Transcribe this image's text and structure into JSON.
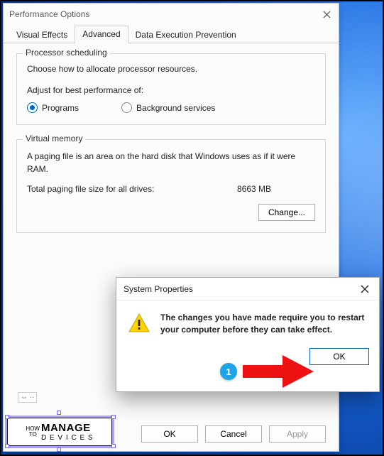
{
  "perf": {
    "title": "Performance Options",
    "tabs": [
      "Visual Effects",
      "Advanced",
      "Data Execution Prevention"
    ],
    "active_tab": 1,
    "processor": {
      "legend": "Processor scheduling",
      "desc": "Choose how to allocate processor resources.",
      "sub": "Adjust for best performance of:",
      "options": [
        "Programs",
        "Background services"
      ],
      "selected": 0
    },
    "vm": {
      "legend": "Virtual memory",
      "desc": "A paging file is an area on the hard disk that Windows uses as if it were RAM.",
      "total_label": "Total paging file size for all drives:",
      "total_value": "8663 MB",
      "change": "Change..."
    },
    "footer": {
      "ok": "OK",
      "cancel": "Cancel",
      "apply": "Apply"
    }
  },
  "msg": {
    "title": "System Properties",
    "text": "The changes you have made require you to restart your computer before they can take effect.",
    "ok": "OK"
  },
  "callout": {
    "num": "1"
  },
  "watermark": {
    "how1": "HOW",
    "how2": "TO",
    "main": "MANAGE",
    "sub": "D E V I C E S"
  }
}
